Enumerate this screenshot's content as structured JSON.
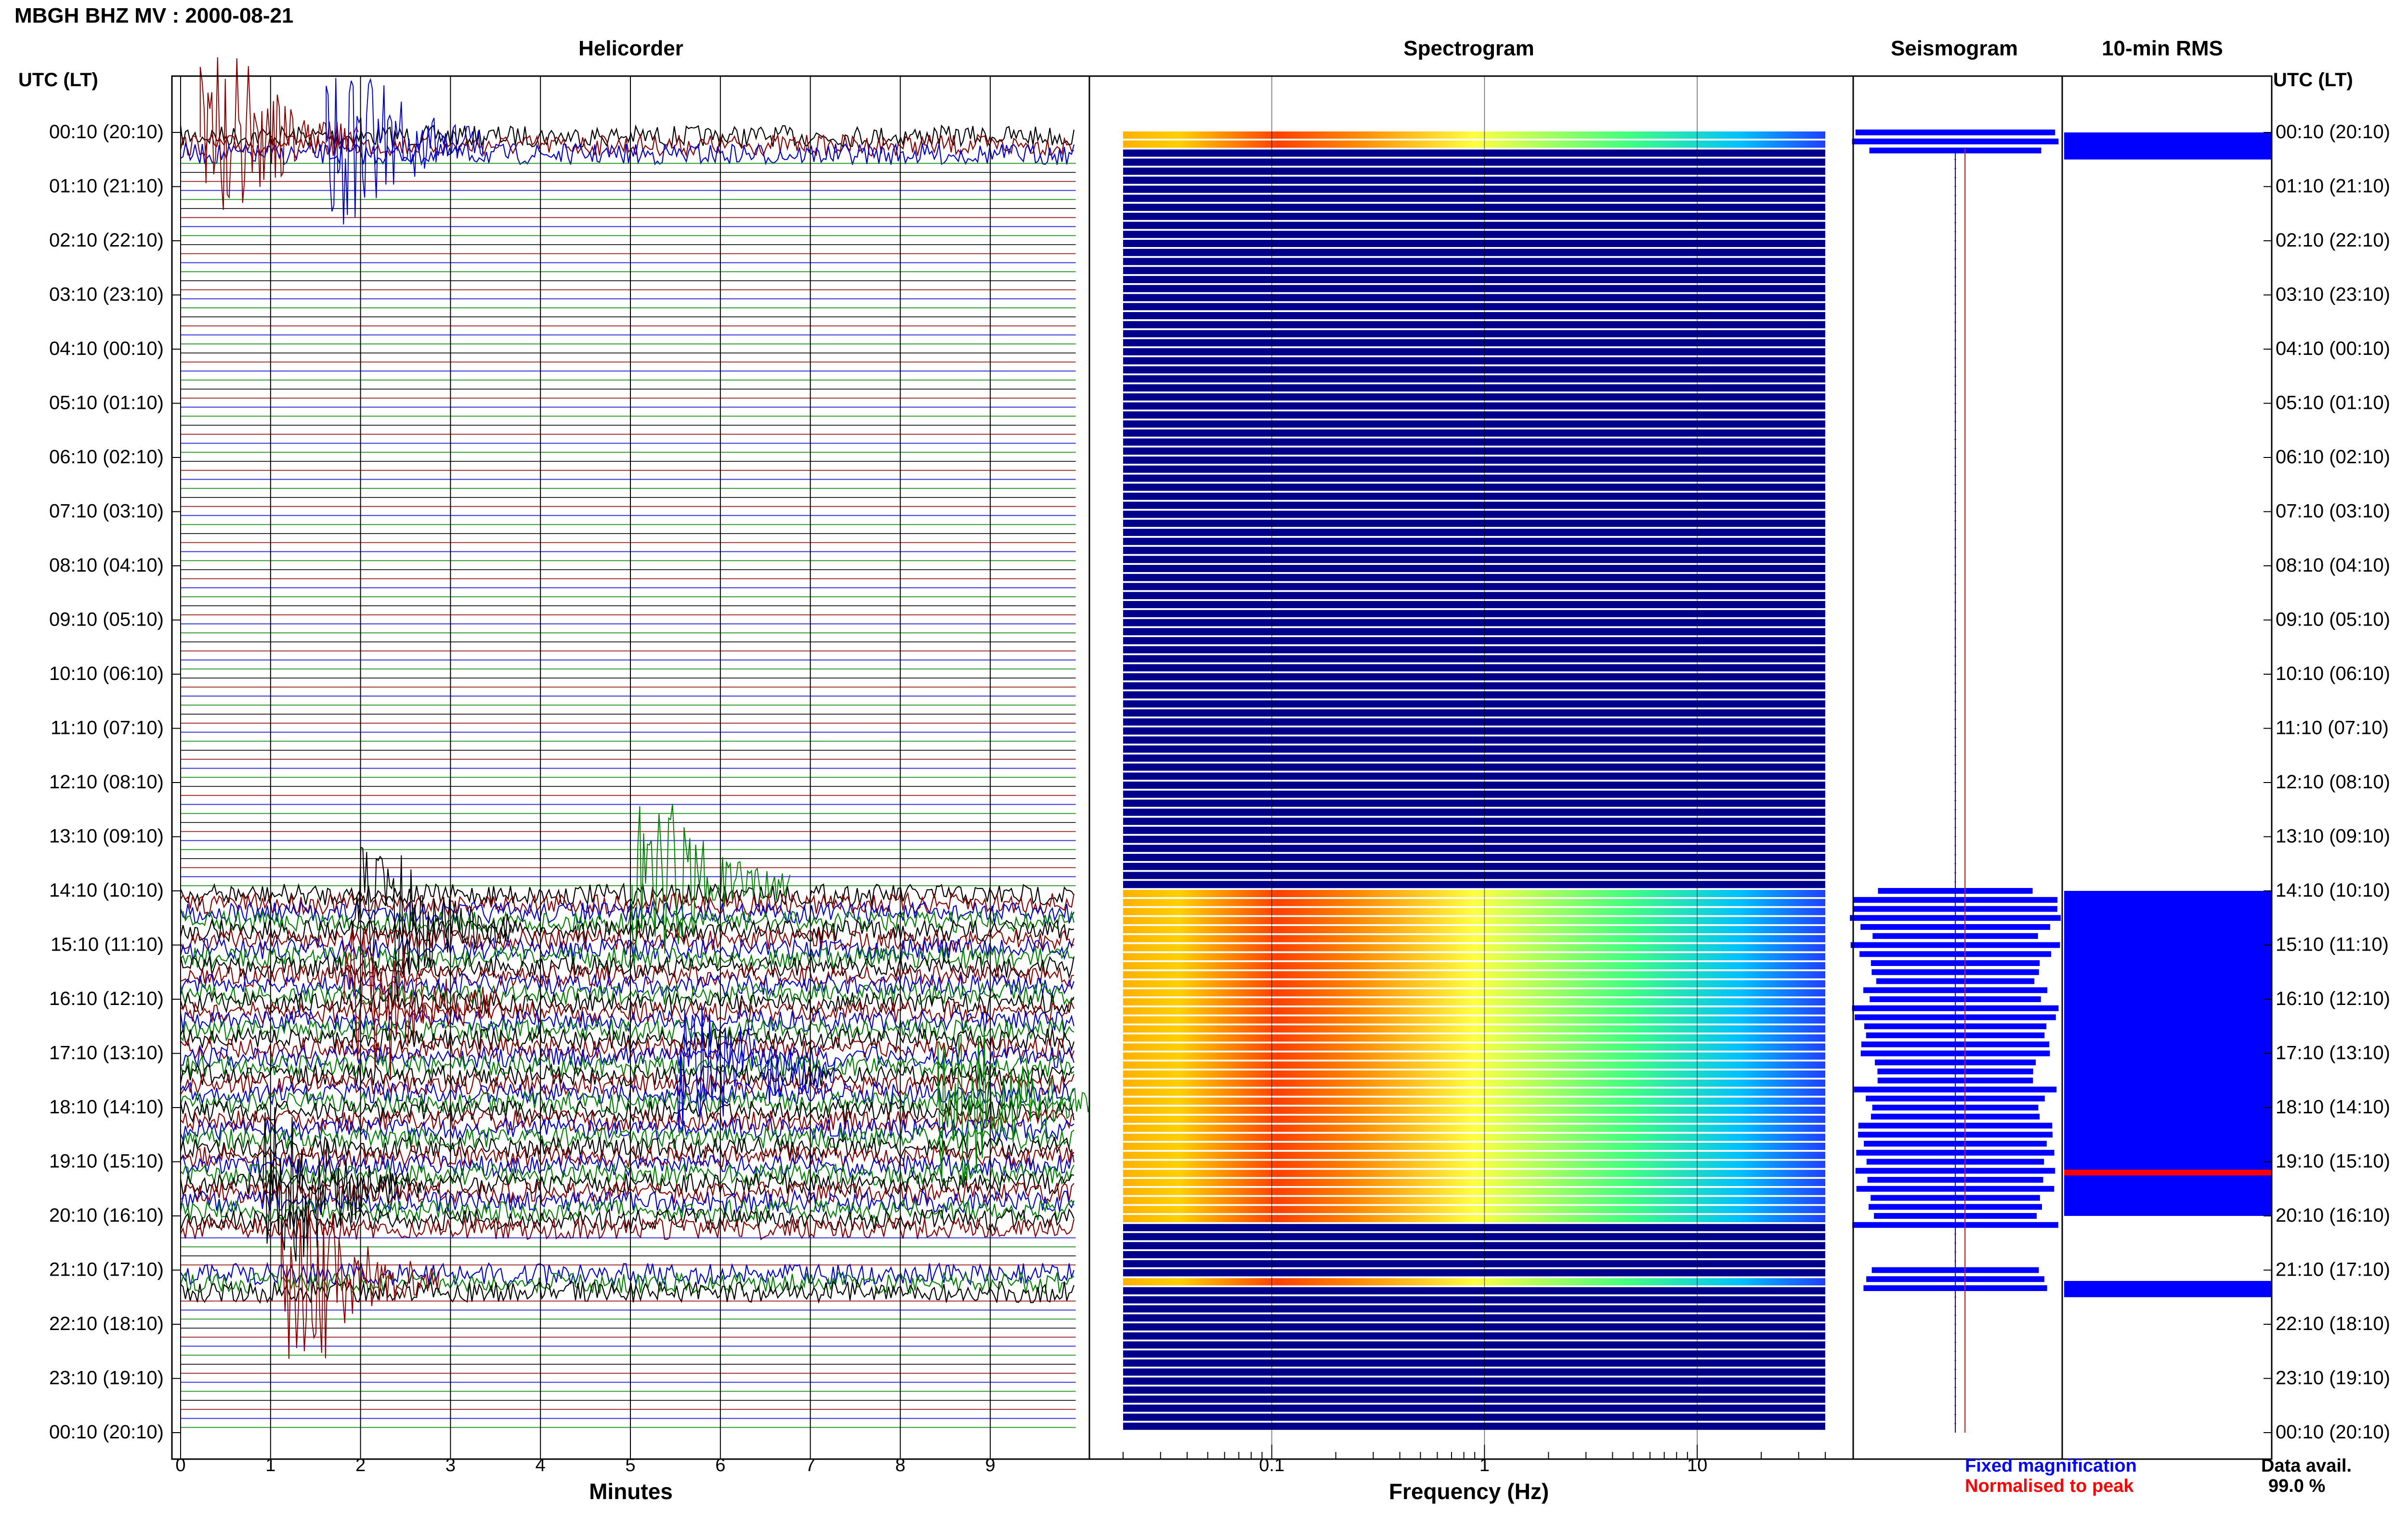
{
  "title": "MBGH BHZ MV : 2000-08-21",
  "panels": {
    "helicorder": "Helicorder",
    "spectrogram": "Spectrogram",
    "seismogram": "Seismogram",
    "rms": "10-min RMS"
  },
  "axis_header_left": "UTC (LT)",
  "axis_header_right": "UTC (LT)",
  "time_labels": [
    "00:10 (20:10)",
    "01:10 (21:10)",
    "02:10 (22:10)",
    "03:10 (23:10)",
    "04:10 (00:10)",
    "05:10 (01:10)",
    "06:10 (02:10)",
    "07:10 (03:10)",
    "08:10 (04:10)",
    "09:10 (05:10)",
    "10:10 (06:10)",
    "11:10 (07:10)",
    "12:10 (08:10)",
    "13:10 (09:10)",
    "14:10 (10:10)",
    "15:10 (11:10)",
    "16:10 (12:10)",
    "17:10 (13:10)",
    "18:10 (14:10)",
    "19:10 (15:10)",
    "20:10 (16:10)",
    "21:10 (17:10)",
    "22:10 (18:10)",
    "23:10 (19:10)",
    "00:10 (20:10)"
  ],
  "x_labels": {
    "helicorder": "Minutes",
    "spectrogram": "Frequency (Hz)"
  },
  "legend": {
    "fixed": "Fixed magnification",
    "normalised": "Normalised to peak"
  },
  "data_avail": {
    "label": "Data avail.",
    "value": "99.0 %"
  },
  "colors": {
    "trace_cycle": [
      "#000000",
      "#8b0000",
      "#0000cd",
      "#008000"
    ],
    "spectrogram_background": "#00008b",
    "fixed": "#0000ff",
    "normalised": "#ff0000"
  },
  "chart_data": [
    {
      "type": "line",
      "name": "helicorder",
      "xlabel": "Minutes",
      "xlim": [
        0,
        10
      ],
      "xticks": [
        0,
        1,
        2,
        3,
        4,
        5,
        6,
        7,
        8,
        9
      ],
      "ylim_hours": [
        0,
        24
      ],
      "active_periods_hours": [
        [
          0,
          0.45
        ],
        [
          14,
          20.2
        ],
        [
          20.9,
          21.4
        ]
      ],
      "events": [
        {
          "hour": 0.0,
          "minute": 0.7
        },
        {
          "hour": 0.1,
          "minute": 2.1
        },
        {
          "hour": 13.8,
          "minute": 5.5
        },
        {
          "hour": 14.6,
          "minute": 2.4
        },
        {
          "hour": 16.0,
          "minute": 2.3
        },
        {
          "hour": 17.3,
          "minute": 6.0
        },
        {
          "hour": 17.8,
          "minute": 8.9
        },
        {
          "hour": 19.4,
          "minute": 1.4
        },
        {
          "hour": 21.1,
          "minute": 1.6
        }
      ]
    },
    {
      "type": "heatmap",
      "name": "spectrogram",
      "xlabel": "Frequency (Hz)",
      "x_scale": "log",
      "xlim_hz": [
        0.02,
        40
      ],
      "xticks": [
        0.1,
        1,
        10
      ],
      "active_periods_hours": [
        [
          0,
          0.3
        ],
        [
          14,
          20
        ],
        [
          21.1,
          21.2
        ]
      ],
      "peak_frequency_hz": 0.3
    },
    {
      "type": "bar",
      "name": "10-min RMS",
      "ylim_hours": [
        0,
        24
      ],
      "active_periods_hours": [
        [
          0,
          0.5
        ],
        [
          14,
          20
        ],
        [
          21.2,
          21.5
        ]
      ],
      "peak_hour": 19.2
    }
  ]
}
